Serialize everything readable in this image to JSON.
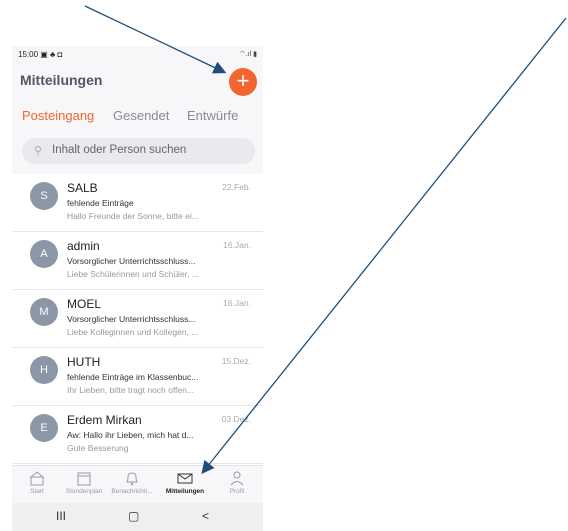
{
  "status_bar": {
    "time": "15:00",
    "left_icons": "▣ ♣ ◘",
    "right_icons": "⌔.ıl ▮"
  },
  "header": {
    "title": "Mitteilungen",
    "add_symbol": "+"
  },
  "tabs": [
    {
      "label": "Posteingang",
      "active": true
    },
    {
      "label": "Gesendet",
      "active": false
    },
    {
      "label": "Entwürfe",
      "active": false
    }
  ],
  "search": {
    "placeholder": "Inhalt oder Person suchen"
  },
  "messages": [
    {
      "initial": "S",
      "sender": "SALB",
      "date": "22.Feb.",
      "subject": "fehlende Einträge",
      "preview": "Hallo Freunde der Sonne, bitte ei..."
    },
    {
      "initial": "A",
      "sender": "admin",
      "date": "16.Jan.",
      "subject": "Vorsorglicher Unterrichtsschluss...",
      "preview": "Liebe Schülerinnen und Schüler, ..."
    },
    {
      "initial": "M",
      "sender": "MOEL",
      "date": "16.Jan.",
      "subject": "Vorsorglicher Unterrichtsschluss...",
      "preview": "Liebe Kolleginnen und Kollegen, ..."
    },
    {
      "initial": "H",
      "sender": "HUTH",
      "date": "15.Dez.",
      "subject": "fehlende Einträge im Klassenbuc...",
      "preview": "Ihr Lieben, bitte tragt noch offen..."
    },
    {
      "initial": "E",
      "sender": "Erdem Mirkan",
      "date": "03.Dez.",
      "subject": "Aw: Hallo ihr Lieben, mich hat d...",
      "preview": "Gute Besserung"
    }
  ],
  "bottom_nav": [
    {
      "label": "Start",
      "icon": "home-icon",
      "active": false
    },
    {
      "label": "Stundenplan",
      "icon": "calendar-icon",
      "active": false
    },
    {
      "label": "Benachrichti...",
      "icon": "bell-icon",
      "active": false
    },
    {
      "label": "Mitteilungen",
      "icon": "envelope-icon",
      "active": true
    },
    {
      "label": "Profil",
      "icon": "person-icon",
      "active": false
    }
  ],
  "system_nav": {
    "recents": "III",
    "home": "▢",
    "back": "<"
  },
  "colors": {
    "accent": "#f26531",
    "arrow": "#1f4e79",
    "avatar": "#8b96a6"
  }
}
